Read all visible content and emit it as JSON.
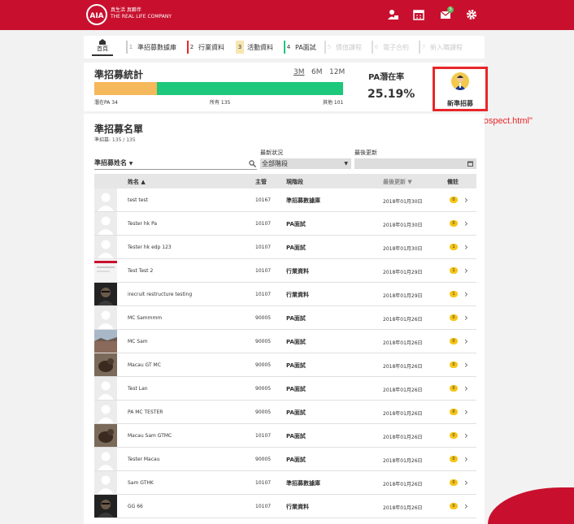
{
  "brand": {
    "line1": "真生活 真夥伴",
    "line2": "THE REAL LIFE COMPANY",
    "logo_text": "AIA"
  },
  "top_icons": [
    "user-icon",
    "calendar-icon",
    "mail-icon",
    "gear-icon"
  ],
  "mail_badge": "5",
  "tabs": [
    {
      "label": "首頁"
    },
    {
      "num": "1",
      "label": "準招募數據庫"
    },
    {
      "num": "2",
      "label": "行業資料"
    },
    {
      "num": "3",
      "label": "活動資料"
    },
    {
      "num": "4",
      "label": "PA面試"
    },
    {
      "num": "5",
      "label": "價值課程"
    },
    {
      "num": "6",
      "label": "電子合約"
    },
    {
      "num": "7",
      "label": "新入職課程"
    }
  ],
  "stats": {
    "title": "準招募統計",
    "ranges": [
      "3M",
      "6M",
      "12M"
    ],
    "active_range": "3M",
    "bar": [
      {
        "label": "潛在PA",
        "value": 34,
        "color": "#f5b85a"
      },
      {
        "label": "所有",
        "value": 135,
        "color": "#1dc77c"
      },
      {
        "label": "其他",
        "value": 101
      }
    ],
    "bar_labels": {
      "pa": "潛在PA 34",
      "all": "所有 135",
      "other": "其他 101"
    },
    "rate_label": "PA潛在率",
    "rate_value": "25.19%"
  },
  "new_prospect": {
    "label": "新準招募",
    "annotation": "navPush=\"createProspect.html\""
  },
  "list": {
    "title": "準招募名單",
    "count": "準招募: 135 / 135",
    "filters": {
      "name_label": "準招募姓名",
      "status_label": "最新狀況",
      "status_value": "全部階段",
      "updated_label": "最後更新"
    },
    "headers": {
      "name": "姓名",
      "manager": "主管",
      "stage": "現階段",
      "updated": "最後更新",
      "remark": "備註"
    },
    "rows": [
      {
        "name": "test test",
        "manager": "10167",
        "stage": "準招募數據庫",
        "date": "2018年01月30日",
        "remark": "0",
        "avatar": "placeholder"
      },
      {
        "name": "Tester hk Pa",
        "manager": "10107",
        "stage": "PA面試",
        "date": "2018年01月30日",
        "remark": "0",
        "avatar": "placeholder"
      },
      {
        "name": "Tester hk edp 123",
        "manager": "10107",
        "stage": "PA面試",
        "date": "2018年01月30日",
        "remark": "1",
        "avatar": "placeholder"
      },
      {
        "name": "Test Test 2",
        "manager": "10107",
        "stage": "行業資料",
        "date": "2018年01月29日",
        "remark": "1",
        "avatar": "card"
      },
      {
        "name": "irecruit restructure testing",
        "manager": "10107",
        "stage": "行業資料",
        "date": "2018年01月29日",
        "remark": "1",
        "avatar": "dark"
      },
      {
        "name": "MC Sammmm",
        "manager": "90005",
        "stage": "PA面試",
        "date": "2018年01月26日",
        "remark": "0",
        "avatar": "placeholder"
      },
      {
        "name": "MC Sam",
        "manager": "90005",
        "stage": "PA面試",
        "date": "2018年01月26日",
        "remark": "0",
        "avatar": "landscape"
      },
      {
        "name": "Macau GT MC",
        "manager": "90005",
        "stage": "PA面試",
        "date": "2018年01月26日",
        "remark": "0",
        "avatar": "animal"
      },
      {
        "name": "Test Lan",
        "manager": "90005",
        "stage": "PA面試",
        "date": "2018年01月26日",
        "remark": "0",
        "avatar": "placeholder"
      },
      {
        "name": "PA MC TESTER",
        "manager": "90005",
        "stage": "PA面試",
        "date": "2018年01月26日",
        "remark": "0",
        "avatar": "placeholder"
      },
      {
        "name": "Macau Sam GTMC",
        "manager": "10107",
        "stage": "PA面試",
        "date": "2018年01月26日",
        "remark": "0",
        "avatar": "animal"
      },
      {
        "name": "Tester Macau",
        "manager": "90005",
        "stage": "PA面試",
        "date": "2018年01月26日",
        "remark": "0",
        "avatar": "placeholder"
      },
      {
        "name": "Sam GTHK",
        "manager": "10107",
        "stage": "準招募數據庫",
        "date": "2018年01月26日",
        "remark": "0",
        "avatar": "placeholder"
      },
      {
        "name": "GG 66",
        "manager": "10107",
        "stage": "行業資料",
        "date": "2018年01月26日",
        "remark": "0",
        "avatar": "dark"
      }
    ]
  }
}
